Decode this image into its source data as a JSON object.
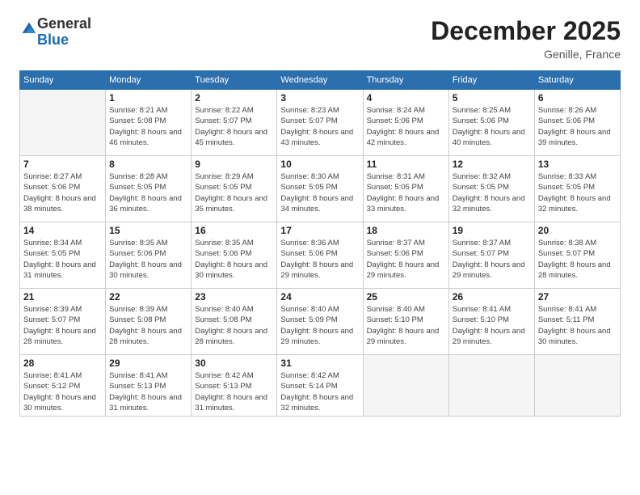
{
  "logo": {
    "general": "General",
    "blue": "Blue"
  },
  "header": {
    "month": "December 2025",
    "location": "Genille, France"
  },
  "weekdays": [
    "Sunday",
    "Monday",
    "Tuesday",
    "Wednesday",
    "Thursday",
    "Friday",
    "Saturday"
  ],
  "weeks": [
    [
      {
        "day": "",
        "empty": true
      },
      {
        "day": "1",
        "sunrise": "Sunrise: 8:21 AM",
        "sunset": "Sunset: 5:08 PM",
        "daylight": "Daylight: 8 hours and 46 minutes."
      },
      {
        "day": "2",
        "sunrise": "Sunrise: 8:22 AM",
        "sunset": "Sunset: 5:07 PM",
        "daylight": "Daylight: 8 hours and 45 minutes."
      },
      {
        "day": "3",
        "sunrise": "Sunrise: 8:23 AM",
        "sunset": "Sunset: 5:07 PM",
        "daylight": "Daylight: 8 hours and 43 minutes."
      },
      {
        "day": "4",
        "sunrise": "Sunrise: 8:24 AM",
        "sunset": "Sunset: 5:06 PM",
        "daylight": "Daylight: 8 hours and 42 minutes."
      },
      {
        "day": "5",
        "sunrise": "Sunrise: 8:25 AM",
        "sunset": "Sunset: 5:06 PM",
        "daylight": "Daylight: 8 hours and 40 minutes."
      },
      {
        "day": "6",
        "sunrise": "Sunrise: 8:26 AM",
        "sunset": "Sunset: 5:06 PM",
        "daylight": "Daylight: 8 hours and 39 minutes."
      }
    ],
    [
      {
        "day": "7",
        "sunrise": "Sunrise: 8:27 AM",
        "sunset": "Sunset: 5:06 PM",
        "daylight": "Daylight: 8 hours and 38 minutes."
      },
      {
        "day": "8",
        "sunrise": "Sunrise: 8:28 AM",
        "sunset": "Sunset: 5:05 PM",
        "daylight": "Daylight: 8 hours and 36 minutes."
      },
      {
        "day": "9",
        "sunrise": "Sunrise: 8:29 AM",
        "sunset": "Sunset: 5:05 PM",
        "daylight": "Daylight: 8 hours and 35 minutes."
      },
      {
        "day": "10",
        "sunrise": "Sunrise: 8:30 AM",
        "sunset": "Sunset: 5:05 PM",
        "daylight": "Daylight: 8 hours and 34 minutes."
      },
      {
        "day": "11",
        "sunrise": "Sunrise: 8:31 AM",
        "sunset": "Sunset: 5:05 PM",
        "daylight": "Daylight: 8 hours and 33 minutes."
      },
      {
        "day": "12",
        "sunrise": "Sunrise: 8:32 AM",
        "sunset": "Sunset: 5:05 PM",
        "daylight": "Daylight: 8 hours and 32 minutes."
      },
      {
        "day": "13",
        "sunrise": "Sunrise: 8:33 AM",
        "sunset": "Sunset: 5:05 PM",
        "daylight": "Daylight: 8 hours and 32 minutes."
      }
    ],
    [
      {
        "day": "14",
        "sunrise": "Sunrise: 8:34 AM",
        "sunset": "Sunset: 5:05 PM",
        "daylight": "Daylight: 8 hours and 31 minutes."
      },
      {
        "day": "15",
        "sunrise": "Sunrise: 8:35 AM",
        "sunset": "Sunset: 5:06 PM",
        "daylight": "Daylight: 8 hours and 30 minutes."
      },
      {
        "day": "16",
        "sunrise": "Sunrise: 8:35 AM",
        "sunset": "Sunset: 5:06 PM",
        "daylight": "Daylight: 8 hours and 30 minutes."
      },
      {
        "day": "17",
        "sunrise": "Sunrise: 8:36 AM",
        "sunset": "Sunset: 5:06 PM",
        "daylight": "Daylight: 8 hours and 29 minutes."
      },
      {
        "day": "18",
        "sunrise": "Sunrise: 8:37 AM",
        "sunset": "Sunset: 5:06 PM",
        "daylight": "Daylight: 8 hours and 29 minutes."
      },
      {
        "day": "19",
        "sunrise": "Sunrise: 8:37 AM",
        "sunset": "Sunset: 5:07 PM",
        "daylight": "Daylight: 8 hours and 29 minutes."
      },
      {
        "day": "20",
        "sunrise": "Sunrise: 8:38 AM",
        "sunset": "Sunset: 5:07 PM",
        "daylight": "Daylight: 8 hours and 28 minutes."
      }
    ],
    [
      {
        "day": "21",
        "sunrise": "Sunrise: 8:39 AM",
        "sunset": "Sunset: 5:07 PM",
        "daylight": "Daylight: 8 hours and 28 minutes."
      },
      {
        "day": "22",
        "sunrise": "Sunrise: 8:39 AM",
        "sunset": "Sunset: 5:08 PM",
        "daylight": "Daylight: 8 hours and 28 minutes."
      },
      {
        "day": "23",
        "sunrise": "Sunrise: 8:40 AM",
        "sunset": "Sunset: 5:08 PM",
        "daylight": "Daylight: 8 hours and 28 minutes."
      },
      {
        "day": "24",
        "sunrise": "Sunrise: 8:40 AM",
        "sunset": "Sunset: 5:09 PM",
        "daylight": "Daylight: 8 hours and 29 minutes."
      },
      {
        "day": "25",
        "sunrise": "Sunrise: 8:40 AM",
        "sunset": "Sunset: 5:10 PM",
        "daylight": "Daylight: 8 hours and 29 minutes."
      },
      {
        "day": "26",
        "sunrise": "Sunrise: 8:41 AM",
        "sunset": "Sunset: 5:10 PM",
        "daylight": "Daylight: 8 hours and 29 minutes."
      },
      {
        "day": "27",
        "sunrise": "Sunrise: 8:41 AM",
        "sunset": "Sunset: 5:11 PM",
        "daylight": "Daylight: 8 hours and 30 minutes."
      }
    ],
    [
      {
        "day": "28",
        "sunrise": "Sunrise: 8:41 AM",
        "sunset": "Sunset: 5:12 PM",
        "daylight": "Daylight: 8 hours and 30 minutes."
      },
      {
        "day": "29",
        "sunrise": "Sunrise: 8:41 AM",
        "sunset": "Sunset: 5:13 PM",
        "daylight": "Daylight: 8 hours and 31 minutes."
      },
      {
        "day": "30",
        "sunrise": "Sunrise: 8:42 AM",
        "sunset": "Sunset: 5:13 PM",
        "daylight": "Daylight: 8 hours and 31 minutes."
      },
      {
        "day": "31",
        "sunrise": "Sunrise: 8:42 AM",
        "sunset": "Sunset: 5:14 PM",
        "daylight": "Daylight: 8 hours and 32 minutes."
      },
      {
        "day": "",
        "empty": true
      },
      {
        "day": "",
        "empty": true
      },
      {
        "day": "",
        "empty": true
      }
    ]
  ]
}
